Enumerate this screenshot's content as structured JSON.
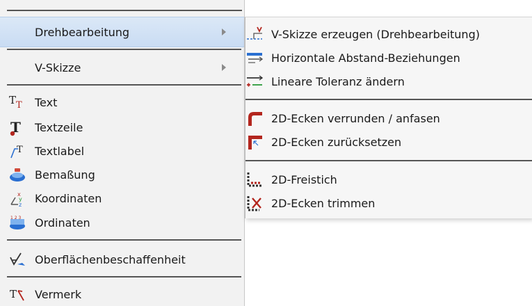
{
  "main_menu": {
    "items": [
      {
        "label": "Drehbearbeitung",
        "icon": "none",
        "has_submenu": true,
        "highlighted": true
      },
      {
        "label": "V-Skizze",
        "icon": "none",
        "has_submenu": true
      },
      {
        "label": "Text",
        "icon": "text-icon"
      },
      {
        "label": "Textzeile",
        "icon": "textline-icon"
      },
      {
        "label": "Textlabel",
        "icon": "textlabel-icon"
      },
      {
        "label": "Bemaßung",
        "icon": "dimension-icon"
      },
      {
        "label": "Koordinaten",
        "icon": "coordinates-icon"
      },
      {
        "label": "Ordinaten",
        "icon": "ordinates-icon"
      },
      {
        "label": "Oberflächenbeschaffenheit",
        "icon": "surface-finish-icon"
      },
      {
        "label": "Vermerk",
        "icon": "note-icon"
      }
    ]
  },
  "submenu": {
    "items": [
      {
        "label": "V-Skizze erzeugen (Drehbearbeitung)",
        "icon": "v-sketch-create-icon"
      },
      {
        "label": "Horizontale Abstand-Beziehungen",
        "icon": "horizontal-distance-icon"
      },
      {
        "label": "Lineare Toleranz ändern",
        "icon": "linear-tolerance-icon"
      },
      {
        "label": "2D-Ecken verrunden / anfasen",
        "icon": "fillet-chamfer-icon"
      },
      {
        "label": "2D-Ecken zurücksetzen",
        "icon": "reset-corners-icon"
      },
      {
        "label": "2D-Freistich",
        "icon": "undercut-icon"
      },
      {
        "label": "2D-Ecken trimmen",
        "icon": "trim-corners-icon"
      }
    ]
  },
  "colors": {
    "highlight": "#c9dcf3",
    "icon_red": "#b3261e",
    "icon_blue": "#2a6fd1",
    "menu_bg": "#f2f2f2"
  }
}
